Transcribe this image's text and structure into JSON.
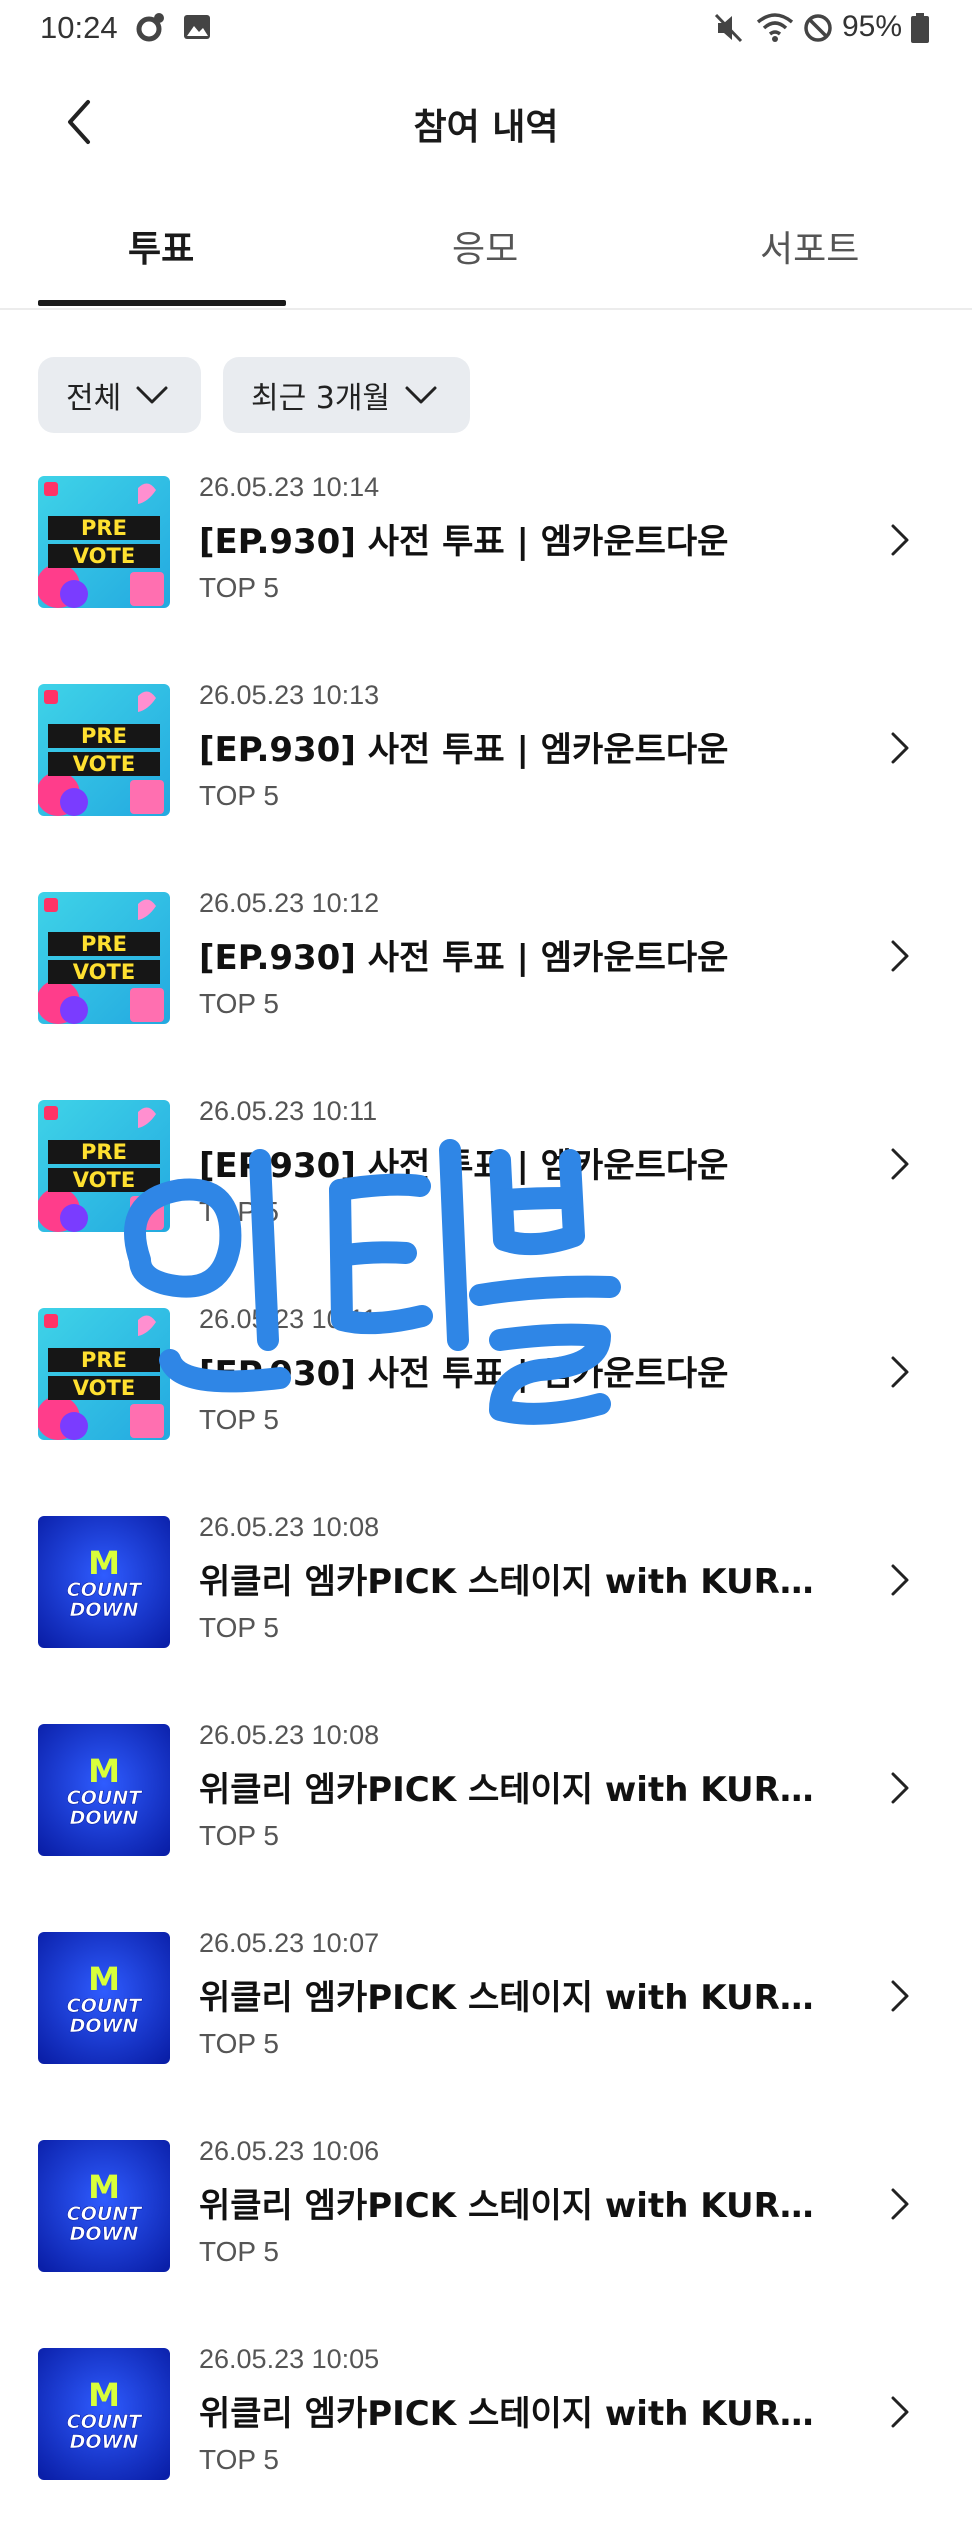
{
  "status_bar": {
    "time": "10:24",
    "battery": "95%"
  },
  "header": {
    "title": "참여 내역"
  },
  "tabs": [
    {
      "label": "투표",
      "active": true
    },
    {
      "label": "응모",
      "active": false
    },
    {
      "label": "서포트",
      "active": false
    }
  ],
  "filters": {
    "category": "전체",
    "period": "최근 3개월"
  },
  "colors": {
    "accent": "#1a1a1a",
    "chip_bg": "#e9ecf0",
    "scribble": "#2f86e6"
  },
  "items": [
    {
      "thumb": "pre-vote",
      "date": "26.05.23 10:14",
      "title": "[EP.930] 사전 투표 | 엠카운트다운",
      "rank": "TOP 5"
    },
    {
      "thumb": "pre-vote",
      "date": "26.05.23 10:13",
      "title": "[EP.930] 사전 투표 | 엠카운트다운",
      "rank": "TOP 5"
    },
    {
      "thumb": "pre-vote",
      "date": "26.05.23 10:12",
      "title": "[EP.930] 사전 투표 | 엠카운트다운",
      "rank": "TOP 5"
    },
    {
      "thumb": "pre-vote",
      "date": "26.05.23 10:11",
      "title": "[EP.930] 사전 투표 | 엠카운트다운",
      "rank": "TOP 5"
    },
    {
      "thumb": "pre-vote",
      "date": "26.05.23 10:11",
      "title": "[EP.930] 사전 투표 | 엠카운트다운",
      "rank": "TOP 5"
    },
    {
      "thumb": "countdown",
      "date": "26.05.23 10:08",
      "title": "위클리 엠카PICK 스테이지 with KURA...",
      "rank": "TOP 5"
    },
    {
      "thumb": "countdown",
      "date": "26.05.23 10:08",
      "title": "위클리 엠카PICK 스테이지 with KURA...",
      "rank": "TOP 5"
    },
    {
      "thumb": "countdown",
      "date": "26.05.23 10:07",
      "title": "위클리 엠카PICK 스테이지 with KURA...",
      "rank": "TOP 5"
    },
    {
      "thumb": "countdown",
      "date": "26.05.23 10:06",
      "title": "위클리 엠카PICK 스테이지 with KURA...",
      "rank": "TOP 5"
    },
    {
      "thumb": "countdown",
      "date": "26.05.23 10:05",
      "title": "위클리 엠카PICK 스테이지 with KURA...",
      "rank": "TOP 5"
    }
  ],
  "thumbs": {
    "pre_vote": {
      "line1": "PRE",
      "line2": "VOTE"
    },
    "countdown": {
      "letter": "M",
      "line1": "COUNT",
      "line2": "DOWN"
    }
  },
  "overlay": {
    "text": "인티블"
  }
}
